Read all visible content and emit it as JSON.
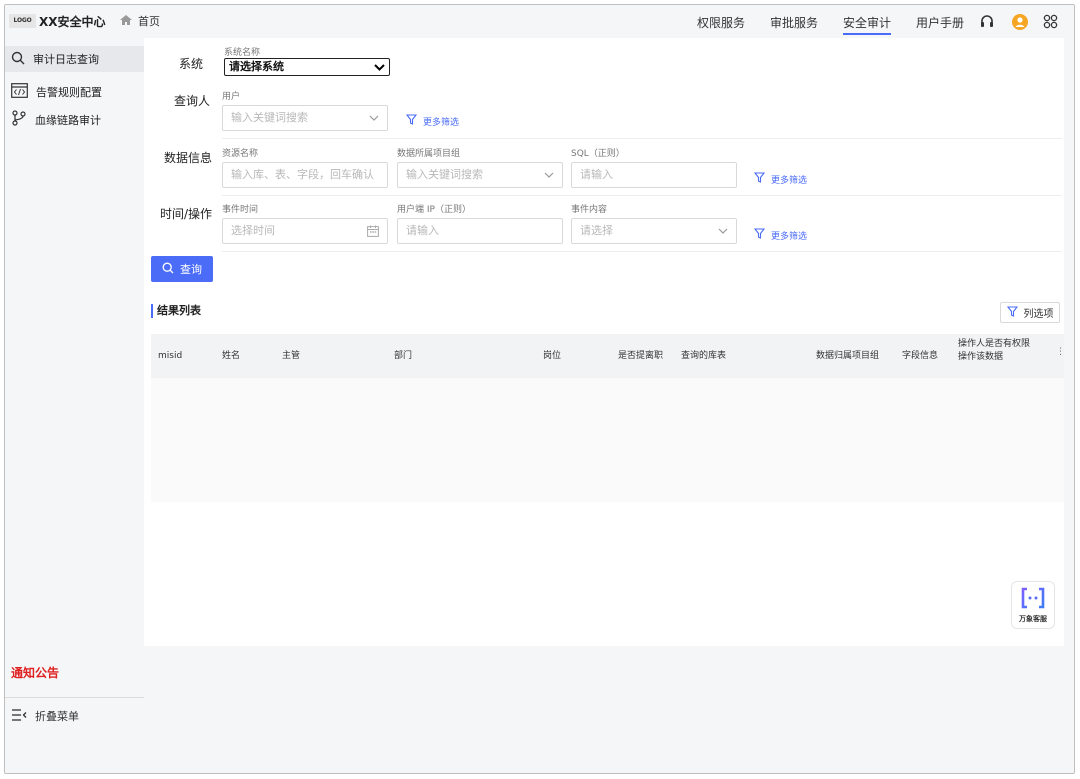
{
  "header": {
    "logo_text": "LOGO",
    "app_title": "XX安全中心",
    "home_label": "首页",
    "nav": [
      {
        "label": "权限服务"
      },
      {
        "label": "审批服务"
      },
      {
        "label": "安全审计"
      },
      {
        "label": "用户手册"
      }
    ],
    "active_nav": "安全审计"
  },
  "sidebar": {
    "items": [
      {
        "label": "审计日志查询",
        "icon": "search-icon"
      },
      {
        "label": "告警规则配置",
        "icon": "code-icon"
      },
      {
        "label": "血缘链路审计",
        "icon": "branch-icon"
      }
    ],
    "notice": "通知公告",
    "collapse_label": "折叠菜单"
  },
  "filters": {
    "system": {
      "row_label": "系统",
      "field_label": "系统名称",
      "value": "请选择系统"
    },
    "querier": {
      "row_label": "查询人",
      "field_label": "用户",
      "placeholder": "输入关键词搜索",
      "more": "更多筛选"
    },
    "data_info": {
      "row_label": "数据信息",
      "resource_label": "资源名称",
      "resource_placeholder": "输入库、表、字段，回车确认",
      "project_label": "数据所属项目组",
      "project_placeholder": "输入关键词搜索",
      "sql_label": "SQL（正则）",
      "sql_placeholder": "请输入",
      "more": "更多筛选"
    },
    "time_op": {
      "row_label": "时间/操作",
      "event_time_label": "事件时间",
      "event_time_placeholder": "选择时间",
      "ip_label": "用户端 IP（正则）",
      "ip_placeholder": "请输入",
      "content_label": "事件内容",
      "content_placeholder": "请选择",
      "more": "更多筛选"
    },
    "query_button": "查询"
  },
  "results": {
    "title": "结果列表",
    "column_button": "列选项",
    "columns": [
      "misid",
      "姓名",
      "主管",
      "部门",
      "岗位",
      "是否提离职",
      "查询的库表",
      "数据归属项目组",
      "字段信息",
      "操作人是否有权限操作该数据"
    ],
    "rows": []
  },
  "float_service": {
    "label": "万象客服"
  },
  "colors": {
    "accent": "#4a6cf7",
    "notice": "#e02020",
    "avatar": "#f5a623"
  }
}
